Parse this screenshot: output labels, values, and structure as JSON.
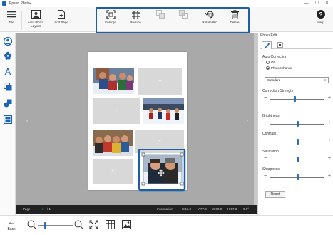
{
  "titlebar": {
    "title": "Epson Photo+"
  },
  "toolbar": {
    "file_label": "File",
    "auto_layout_label": "Auto Photo Layout",
    "add_page_label": "Add Page",
    "enlarge_label": "Enlarge",
    "reduce_label": "Reduce",
    "rotate_label": "Rotate 90°",
    "delete_label": "Delete",
    "help_label": "Help"
  },
  "status": {
    "page_label": "Page",
    "page_value": "1",
    "page_total": "/ 1",
    "info_label": "Information",
    "x_value": "X:13.0",
    "y_value": "Y:77.0",
    "w_value": "W:60.0",
    "h_value": "H:57.3",
    "angle_value": "0.0°"
  },
  "bottombar": {
    "back_label": "Back"
  },
  "panel": {
    "title": "Photo Edit",
    "auto_correction": "Auto Correction",
    "off_label": "Off",
    "photoenhance_label": "PhotoEnhance",
    "mode_value": "Standard",
    "correction_strength": "Correction Strength",
    "brightness": "Brightness",
    "contrast": "Contrast",
    "saturation": "Saturation",
    "sharpness": "Sharpness",
    "reset_label": "Reset"
  },
  "slider_levels": {
    "correction_strength": 0.45,
    "brightness": 0.5,
    "contrast": 0.5,
    "saturation": 0.5,
    "sharpness": 0.5,
    "zoom": 0.2
  },
  "colors": {
    "accent": "#1d5fa6",
    "canvas_bg": "#a9a9a9",
    "slot_placeholder": "#d8d8d8"
  }
}
